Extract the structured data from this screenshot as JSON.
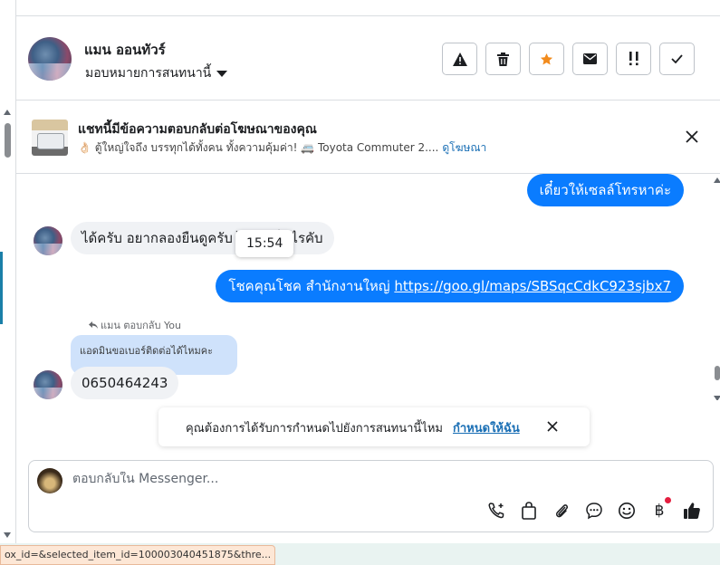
{
  "header": {
    "contact_name": "แมน ออนทัวร์",
    "assign_label": "มอบหมายการสนทนานี้",
    "actions": [
      {
        "icon": "warning-icon",
        "label": "Mark as spam"
      },
      {
        "icon": "trash-icon",
        "label": "Delete"
      },
      {
        "icon": "star-icon",
        "label": "Star"
      },
      {
        "icon": "envelope-icon",
        "label": "Mark as unread"
      },
      {
        "icon": "priority-icon",
        "label": "Priority"
      },
      {
        "icon": "check-icon",
        "label": "Done"
      }
    ]
  },
  "ad_banner": {
    "title": "แชทนี้มีข้อความตอบกลับต่อโฆษณาของคุณ",
    "subtitle": "👌🏻 ตู้ใหญ่ใจถึง บรรทุกได้ทั้งคน ทั้งความคุ้มค่า! 🚐 Toyota Commuter 2....",
    "link": "ดูโฆษณา"
  },
  "messages": [
    {
      "from": "me",
      "text": "เดี๋ยวให้เซลล์โทรหาค่ะ"
    },
    {
      "from": "them",
      "text": "ได้ครับ  อยากลองยืนดูครับ ไม่ไม่เป็นไรคับ"
    },
    {
      "from": "me",
      "text": "โชคคุณโชค สำนักงานใหญ่ ",
      "url": "https://goo.gl/maps/SBSqcCdkC923sjbx7"
    },
    {
      "from": "them",
      "text": "0650464243"
    }
  ],
  "tooltip_time": "15:54",
  "reply_label": "แมน ตอบกลับ You",
  "quoted_text": "แอดมินขอเบอร์ติดต่อได้ไหมคะ",
  "notification": {
    "text": "คุณต้องการได้รับการกำหนดไปยังการสนทนานี้ไหม",
    "link": "กำหนดให้ฉัน"
  },
  "composer": {
    "placeholder": "ตอบกลับใน Messenger...",
    "tools": [
      "call-add-icon",
      "bag-icon",
      "paperclip-icon",
      "chat-bubble-icon",
      "emoji-icon",
      "baht-icon",
      "thumbs-up-icon"
    ]
  },
  "status_url": "ox_id=&selected_item_id=100003040451875&thre..."
}
